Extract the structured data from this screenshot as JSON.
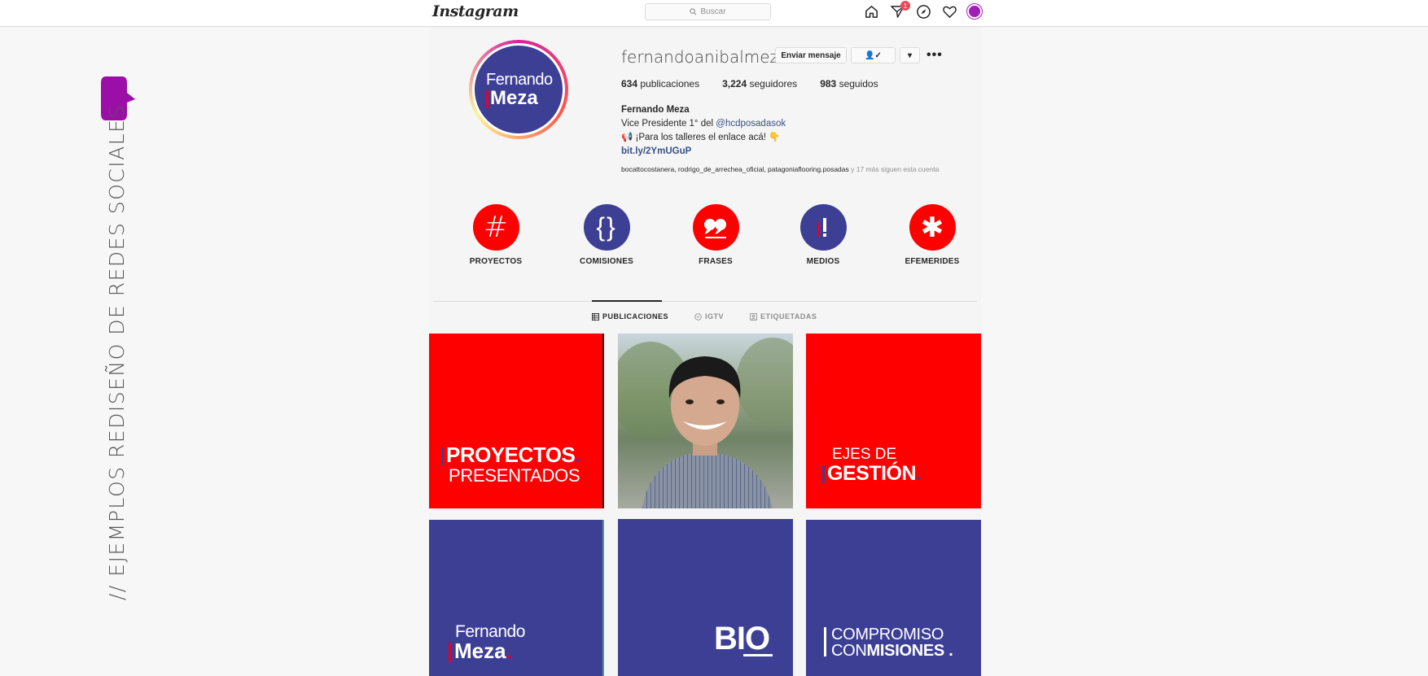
{
  "slide": {
    "vertical_title": "// EJEMPLOS REDISEÑO DE REDES SOCIALES",
    "logo_color": "#9b0fa8"
  },
  "topbar": {
    "logo": "Instagram",
    "search_placeholder": "Buscar",
    "notification_count": "1",
    "icons": [
      "home-icon",
      "direct-icon",
      "explore-icon",
      "heart-icon",
      "avatar"
    ]
  },
  "profile": {
    "avatar_line1": "Fernando",
    "avatar_line2": "Meza",
    "username": "fernandoanibalmeza",
    "message_button": "Enviar mensaje",
    "follow_button": "👤✓",
    "dropdown_button": "▾",
    "more_button": "•••",
    "stats": {
      "posts_count": "634",
      "posts_label": "publicaciones",
      "followers_count": "3,224",
      "followers_label": "seguidores",
      "following_count": "983",
      "following_label": "seguidos"
    },
    "bio": {
      "name": "Fernando Meza",
      "line1_prefix": "Vice Presidente 1° del ",
      "line1_mention": "@hcdposadasok",
      "line2": "📢 ¡Para los talleres el enlace acá! 👇",
      "link": "bit.ly/2YmUGuP"
    },
    "followed_by": "bocattocostanera, rodrigo_de_arrechea_oficial, patagoniaflooring.posadas",
    "followed_by_rest": " y 17 más siguen esta cuenta"
  },
  "highlights": [
    {
      "label": "PROYECTOS",
      "glyph": "#",
      "color": "#ff0000"
    },
    {
      "label": "COMISIONES",
      "glyph": "{}",
      "color": "#3d3f95"
    },
    {
      "label": "FRASES",
      "glyph": "❝",
      "color": "#ff0000"
    },
    {
      "label": "MEDIOS",
      "glyph": "I!",
      "color": "#3d3f95"
    },
    {
      "label": "EFEMERIDES",
      "glyph": "✱",
      "color": "#ff0000"
    }
  ],
  "tabs": [
    {
      "label": "PUBLICACIONES",
      "active": true
    },
    {
      "label": "IGTV",
      "active": false
    },
    {
      "label": "ETIQUETADAS",
      "active": false
    }
  ],
  "posts": {
    "p1_line1": "PROYECTOS",
    "p1_line2": "PRESENTADOS",
    "p3_line1": "EJES DE",
    "p3_line2": "GESTIÓN",
    "p4_line1": "Fernando",
    "p4_line2": "Meza",
    "p5_text": "BIO",
    "p6_line1": "COMPROMISO",
    "p6_line2a": "CON",
    "p6_line2b": "MISIONES"
  },
  "colors": {
    "brand_red": "#ff0000",
    "brand_blue": "#3d3f95",
    "accent_red": "#e4002b"
  }
}
